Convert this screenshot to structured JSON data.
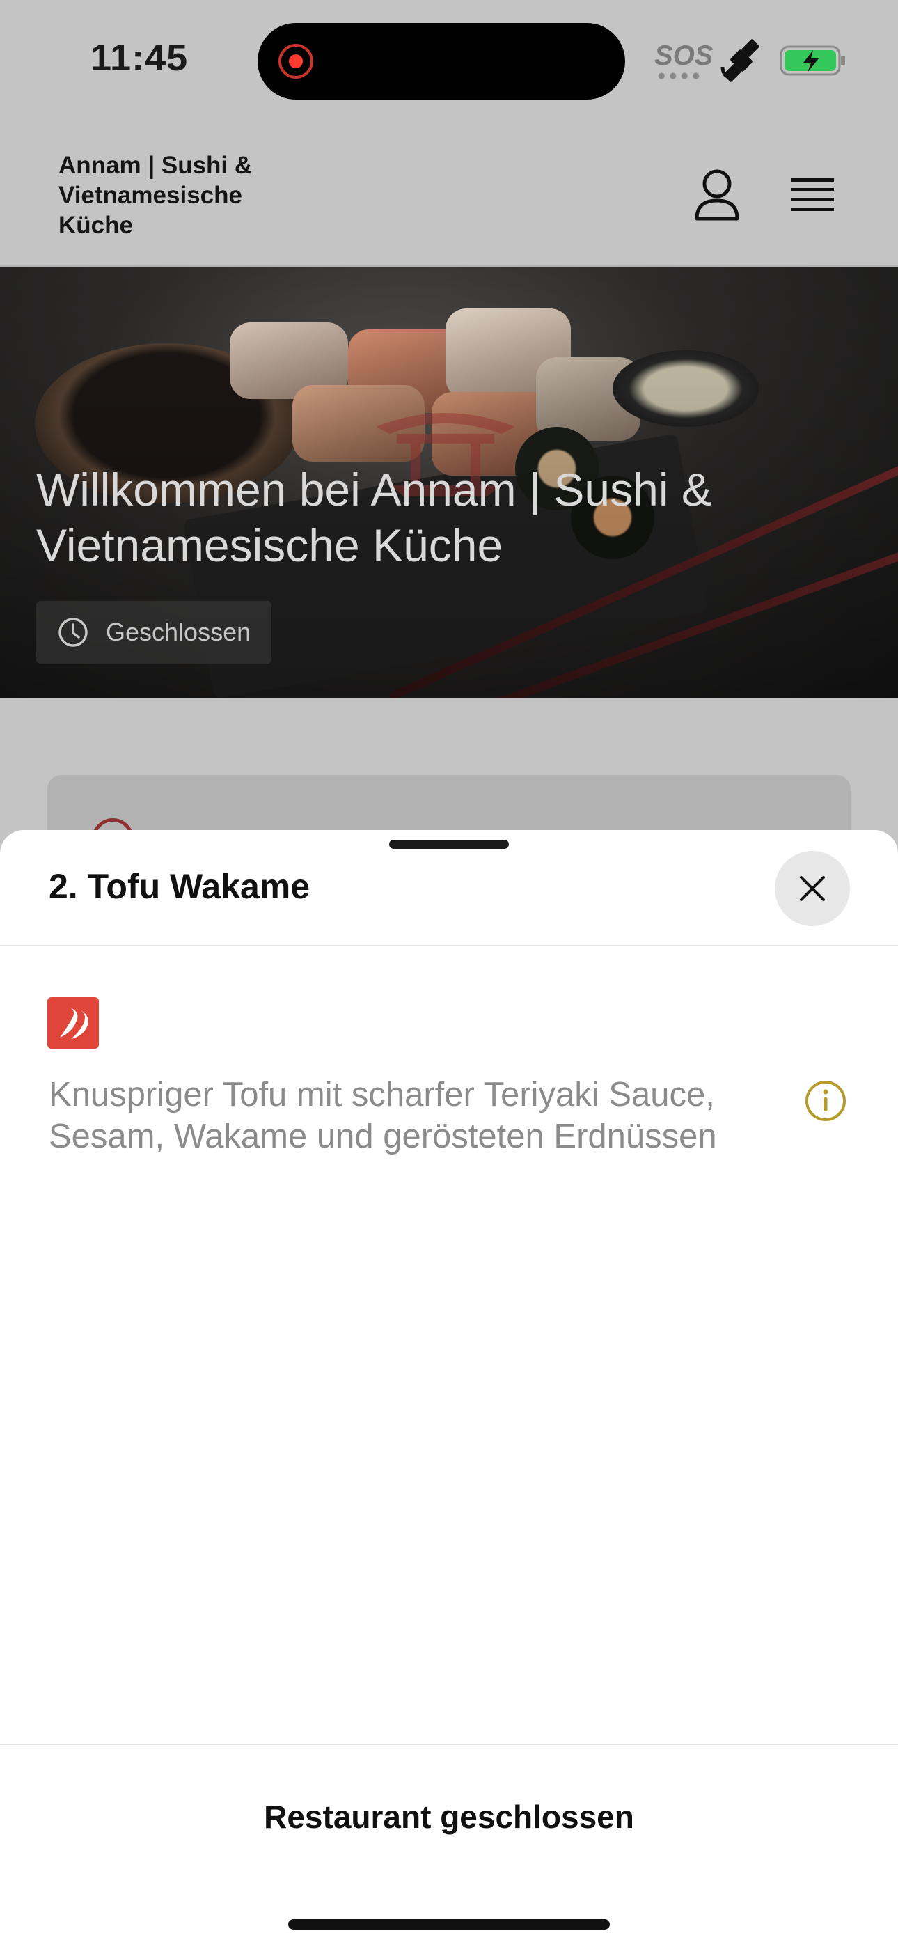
{
  "status_bar": {
    "time": "11:45",
    "sos": "SOS",
    "recording_color": "#ff3b30",
    "battery_color": "#34c759"
  },
  "header": {
    "brand": "Annam | Sushi & Vietnamesische Küche",
    "user_icon": "user-icon",
    "menu_icon": "hamburger-menu-icon"
  },
  "hero": {
    "title": "Willkommen bei Annam | Sushi & Vietnamesische Küche",
    "status": "Geschlossen"
  },
  "sheet": {
    "title": "2. Tofu Wakame",
    "spicy_badge_color": "#e0453a",
    "description": "Knuspriger Tofu mit scharfer Teriyaki Sauce, Sesam, Wakame und gerösteten Erdnüssen",
    "info_icon_color": "#b59a2c",
    "footer_label": "Restaurant geschlossen"
  }
}
